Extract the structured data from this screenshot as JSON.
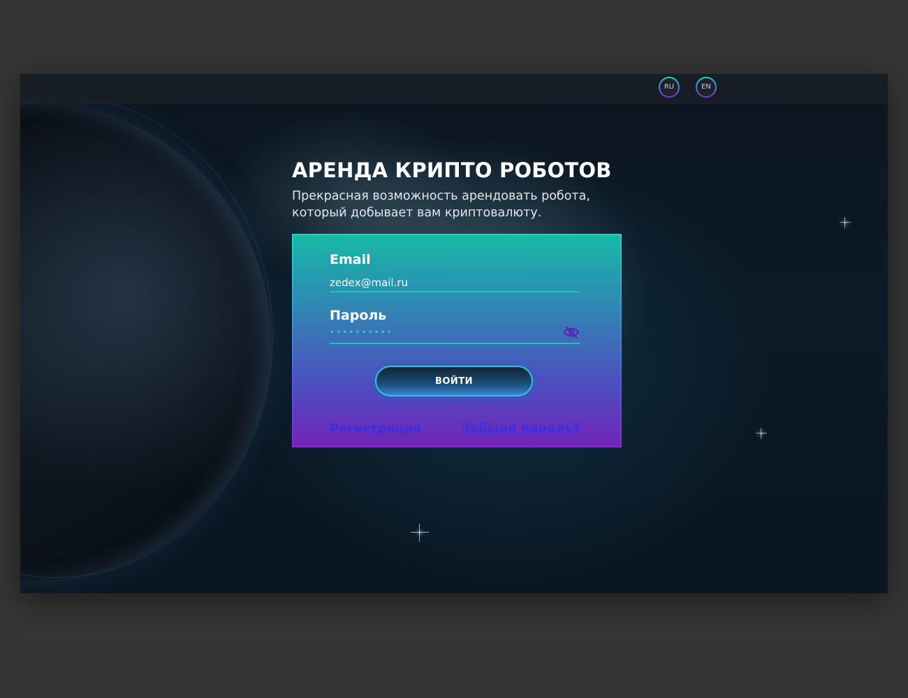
{
  "header": {
    "languages": [
      {
        "code": "RU"
      },
      {
        "code": "EN"
      }
    ]
  },
  "hero": {
    "title": "АРЕНДА КРИПТО РОБОТОВ",
    "subtitle": "Прекрасная возможность арендовать робота, который добывает вам криптовалюту."
  },
  "form": {
    "email_label": "Email",
    "email_value": "zedex@mail.ru",
    "password_label": "Пароль",
    "password_mask": "••••••••••",
    "submit_label": "ВОЙТИ",
    "register_link": "Регистрация",
    "forgot_link": "Забыли пароль?"
  },
  "icons": {
    "visibility_toggle": "eye-off-icon"
  },
  "colors": {
    "page_background": "#353535",
    "accent_teal": "#1ec7b7",
    "accent_purple": "#8a24d8",
    "link_color": "#3d2fe0",
    "button_glow": "#3a86cf"
  }
}
